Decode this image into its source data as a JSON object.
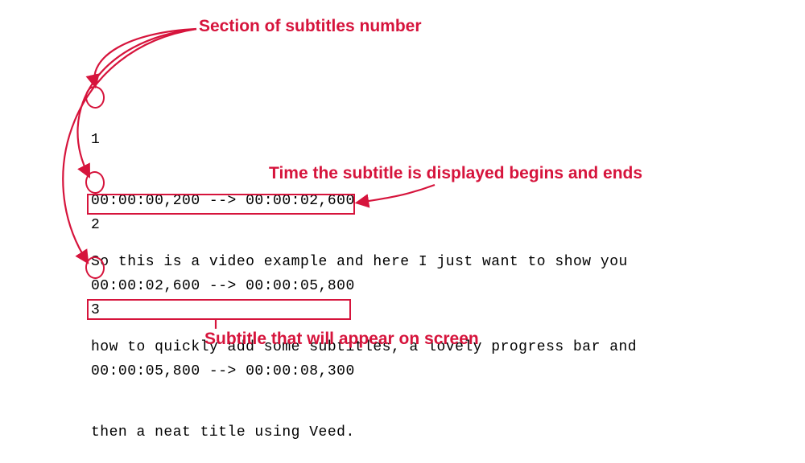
{
  "annotations": {
    "section_label": "Section of subtitles number",
    "time_label": "Time the subtitle is displayed begins and ends",
    "text_label": "Subtitle that will appear on screen"
  },
  "subtitles": [
    {
      "index": "1",
      "time": "00:00:00,200 --> 00:00:02,600",
      "text": "So this is a video example and here I just want to show you"
    },
    {
      "index": "2",
      "time": "00:00:02,600 --> 00:00:05,800",
      "text": "how to quickly add some subtitles, a lovely progress bar and"
    },
    {
      "index": "3",
      "time": "00:00:05,800 --> 00:00:08,300",
      "text": "then a neat title using Veed."
    }
  ],
  "colors": {
    "annotation": "#d6143c",
    "text": "#000000",
    "background": "#ffffff"
  }
}
